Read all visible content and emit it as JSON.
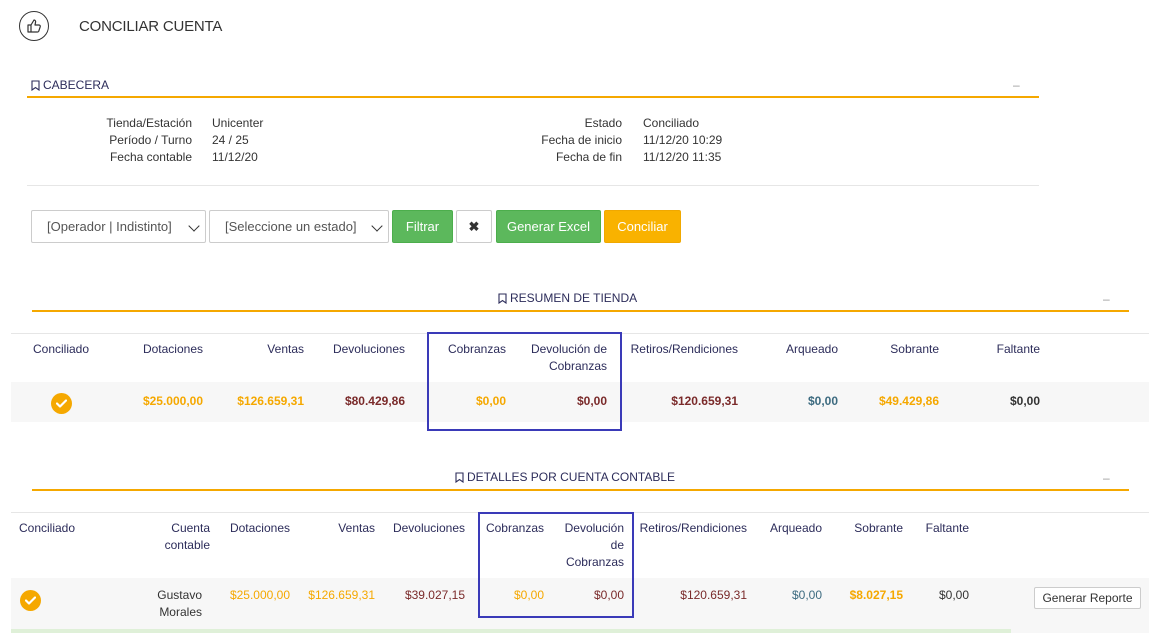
{
  "header": {
    "title": "CONCILIAR CUENTA",
    "icon": "thumbs-up-icon"
  },
  "cabecera": {
    "title": "CABECERA",
    "collapse": "–",
    "left": [
      {
        "label": "Tienda/Estación",
        "value": "Unicenter"
      },
      {
        "label": "Período / Turno",
        "value": "24 / 25"
      },
      {
        "label": "Fecha contable",
        "value": "11/12/20"
      }
    ],
    "right": [
      {
        "label": "Estado",
        "value": "Conciliado"
      },
      {
        "label": "Fecha de inicio",
        "value": "11/12/20 10:29"
      },
      {
        "label": "Fecha de fin",
        "value": "11/12/20 11:35"
      }
    ]
  },
  "filters": {
    "operator": "[Operador | Indistinto]",
    "state": "[Seleccione un estado]",
    "filter_label": "Filtrar",
    "clear_label": "✖",
    "excel_label": "Generar Excel",
    "conciliar_label": "Conciliar"
  },
  "resumen": {
    "title": "RESUMEN DE TIENDA",
    "collapse": "–",
    "headers": {
      "conciliado": "Conciliado",
      "dotaciones": "Dotaciones",
      "ventas": "Ventas",
      "devoluciones": "Devoluciones",
      "cobranzas": "Cobranzas",
      "dev_cobranzas_1": "Devolución de",
      "dev_cobranzas_2": "Cobranzas",
      "retiros": "Retiros/Rendiciones",
      "arqueado": "Arqueado",
      "sobrante": "Sobrante",
      "faltante": "Faltante"
    },
    "row": {
      "dotaciones": "$25.000,00",
      "ventas": "$126.659,31",
      "devoluciones": "$80.429,86",
      "cobranzas": "$0,00",
      "dev_cobranzas": "$0,00",
      "retiros": "$120.659,31",
      "arqueado": "$0,00",
      "sobrante": "$49.429,86",
      "faltante": "$0,00"
    }
  },
  "detalles": {
    "title": "DETALLES POR CUENTA CONTABLE",
    "collapse": "–",
    "headers": {
      "conciliado": "Conciliado",
      "cuenta_1": "Cuenta",
      "cuenta_2": "contable",
      "dotaciones": "Dotaciones",
      "ventas": "Ventas",
      "devoluciones": "Devoluciones",
      "cobranzas": "Cobranzas",
      "dev_1": "Devolución",
      "dev_2": "de",
      "dev_3": "Cobranzas",
      "retiros": "Retiros/Rendiciones",
      "arqueado": "Arqueado",
      "sobrante": "Sobrante",
      "faltante": "Faltante"
    },
    "row": {
      "cuenta_1": "Gustavo",
      "cuenta_2": "Morales",
      "dotaciones": "$25.000,00",
      "ventas": "$126.659,31",
      "devoluciones": "$39.027,15",
      "cobranzas": "$0,00",
      "dev_cobranzas": "$0,00",
      "retiros": "$120.659,31",
      "arqueado": "$0,00",
      "sobrante": "$8.027,15",
      "faltante": "$0,00",
      "report_label": "Generar Reporte"
    }
  },
  "colors": {
    "accent": "#f5a800",
    "success": "#5cb85c",
    "highlight_box": "#3a3ab8"
  }
}
